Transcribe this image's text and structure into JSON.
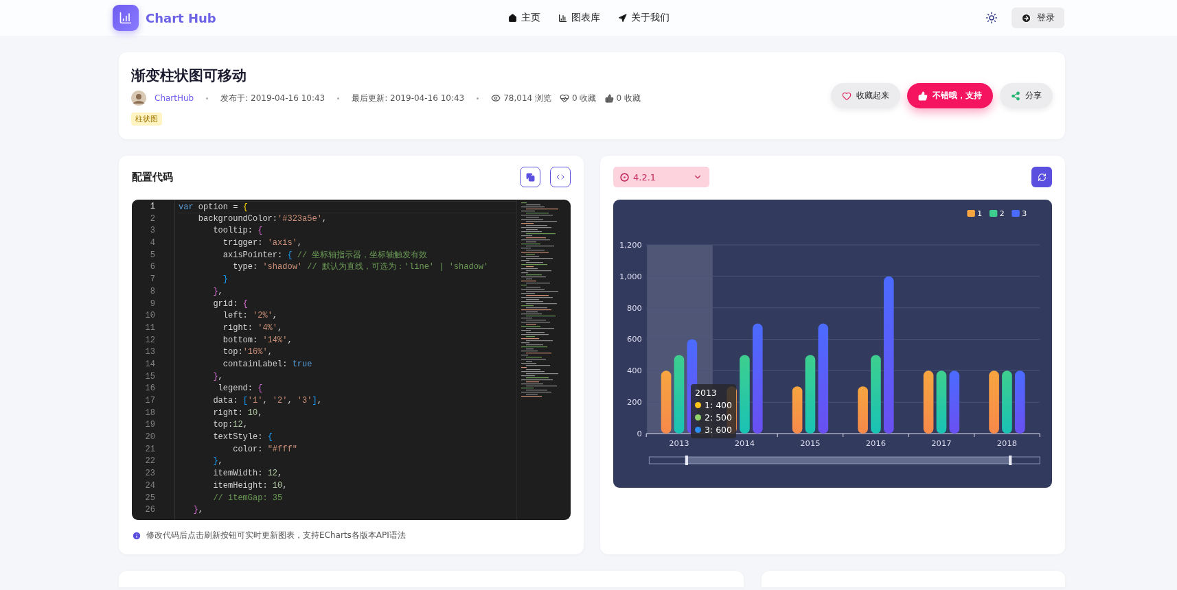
{
  "header": {
    "logo": "Chart Hub",
    "nav": [
      {
        "label": "主页",
        "kind": "home"
      },
      {
        "label": "图表库",
        "kind": "chart"
      },
      {
        "label": "关于我们",
        "kind": "about"
      }
    ],
    "login": "登录"
  },
  "article": {
    "title": "渐变柱状图可移动",
    "author": "ChartHub",
    "published": "发布于: 2019-04-16 10:43",
    "updated": "最后更新: 2019-04-16 10:43",
    "views": "78,014 浏览",
    "favorites": "0 收藏",
    "likes": "0 收藏",
    "tag": "柱状图",
    "actions": [
      {
        "label": "收藏起来",
        "kind": "favorite"
      },
      {
        "label": "不错哦，支持",
        "kind": "like"
      },
      {
        "label": "分享",
        "kind": "share"
      }
    ]
  },
  "code_panel": {
    "title": "配置代码",
    "hint": "修改代码后点击刷新按钮可实时更新图表，支持ECharts各版本API语法",
    "lines": [
      {
        "num": "1",
        "tokens": [
          {
            "text": "var",
            "kind": "keyword"
          },
          {
            "text": " option = ",
            "kind": "plain"
          },
          {
            "text": "{",
            "kind": "bracket1"
          }
        ]
      },
      {
        "num": "2",
        "tokens": [
          {
            "text": "    backgroundColor:",
            "kind": "plain"
          },
          {
            "text": "'#323a5e'",
            "kind": "string"
          },
          {
            "text": ",",
            "kind": "plain"
          }
        ]
      },
      {
        "num": "3",
        "tokens": [
          {
            "text": "       tooltip: ",
            "kind": "plain"
          },
          {
            "text": "{",
            "kind": "bracket2"
          }
        ]
      },
      {
        "num": "4",
        "tokens": [
          {
            "text": "         trigger: ",
            "kind": "plain"
          },
          {
            "text": "'axis'",
            "kind": "string"
          },
          {
            "text": ",",
            "kind": "plain"
          }
        ]
      },
      {
        "num": "5",
        "tokens": [
          {
            "text": "         axisPointer: ",
            "kind": "plain"
          },
          {
            "text": "{",
            "kind": "bracket3"
          },
          {
            "text": " // 坐标轴指示器，坐标轴触发有效",
            "kind": "comment"
          }
        ]
      },
      {
        "num": "6",
        "tokens": [
          {
            "text": "           type: ",
            "kind": "plain"
          },
          {
            "text": "'shadow'",
            "kind": "string"
          },
          {
            "text": " // 默认为直线，可选为：'line' | 'shadow'",
            "kind": "comment"
          }
        ]
      },
      {
        "num": "7",
        "tokens": [
          {
            "text": "         }",
            "kind": "bracket3"
          }
        ]
      },
      {
        "num": "8",
        "tokens": [
          {
            "text": "       }",
            "kind": "bracket2"
          },
          {
            "text": ",",
            "kind": "plain"
          }
        ]
      },
      {
        "num": "9",
        "tokens": [
          {
            "text": "       grid: ",
            "kind": "plain"
          },
          {
            "text": "{",
            "kind": "bracket2"
          }
        ]
      },
      {
        "num": "10",
        "tokens": [
          {
            "text": "         left: ",
            "kind": "plain"
          },
          {
            "text": "'2%'",
            "kind": "string"
          },
          {
            "text": ",",
            "kind": "plain"
          }
        ]
      },
      {
        "num": "11",
        "tokens": [
          {
            "text": "         right: ",
            "kind": "plain"
          },
          {
            "text": "'4%'",
            "kind": "string"
          },
          {
            "text": ",",
            "kind": "plain"
          }
        ]
      },
      {
        "num": "12",
        "tokens": [
          {
            "text": "         bottom: ",
            "kind": "plain"
          },
          {
            "text": "'14%'",
            "kind": "string"
          },
          {
            "text": ",",
            "kind": "plain"
          }
        ]
      },
      {
        "num": "13",
        "tokens": [
          {
            "text": "         top:",
            "kind": "plain"
          },
          {
            "text": "'16%'",
            "kind": "string"
          },
          {
            "text": ",",
            "kind": "plain"
          }
        ]
      },
      {
        "num": "14",
        "tokens": [
          {
            "text": "         containLabel: ",
            "kind": "plain"
          },
          {
            "text": "true",
            "kind": "keyword"
          }
        ]
      },
      {
        "num": "15",
        "tokens": [
          {
            "text": "       }",
            "kind": "bracket2"
          },
          {
            "text": ",",
            "kind": "plain"
          }
        ]
      },
      {
        "num": "16",
        "tokens": [
          {
            "text": "        legend: ",
            "kind": "plain"
          },
          {
            "text": "{",
            "kind": "bracket2"
          }
        ]
      },
      {
        "num": "17",
        "tokens": [
          {
            "text": "       data: ",
            "kind": "plain"
          },
          {
            "text": "[",
            "kind": "bracket3"
          },
          {
            "text": "'1'",
            "kind": "string"
          },
          {
            "text": ", ",
            "kind": "plain"
          },
          {
            "text": "'2'",
            "kind": "string"
          },
          {
            "text": ", ",
            "kind": "plain"
          },
          {
            "text": "'3'",
            "kind": "string"
          },
          {
            "text": "]",
            "kind": "bracket3"
          },
          {
            "text": ",",
            "kind": "plain"
          }
        ]
      },
      {
        "num": "18",
        "tokens": [
          {
            "text": "       right: ",
            "kind": "plain"
          },
          {
            "text": "10",
            "kind": "number"
          },
          {
            "text": ",",
            "kind": "plain"
          }
        ]
      },
      {
        "num": "19",
        "tokens": [
          {
            "text": "       top:",
            "kind": "plain"
          },
          {
            "text": "12",
            "kind": "number"
          },
          {
            "text": ",",
            "kind": "plain"
          }
        ]
      },
      {
        "num": "20",
        "tokens": [
          {
            "text": "       textStyle: ",
            "kind": "plain"
          },
          {
            "text": "{",
            "kind": "bracket3"
          }
        ]
      },
      {
        "num": "21",
        "tokens": [
          {
            "text": "           color: ",
            "kind": "plain"
          },
          {
            "text": "\"#fff\"",
            "kind": "string"
          }
        ]
      },
      {
        "num": "22",
        "tokens": [
          {
            "text": "       }",
            "kind": "bracket3"
          },
          {
            "text": ",",
            "kind": "plain"
          }
        ]
      },
      {
        "num": "23",
        "tokens": [
          {
            "text": "       itemWidth: ",
            "kind": "plain"
          },
          {
            "text": "12",
            "kind": "number"
          },
          {
            "text": ",",
            "kind": "plain"
          }
        ]
      },
      {
        "num": "24",
        "tokens": [
          {
            "text": "       itemHeight: ",
            "kind": "plain"
          },
          {
            "text": "10",
            "kind": "number"
          },
          {
            "text": ",",
            "kind": "plain"
          }
        ]
      },
      {
        "num": "25",
        "tokens": [
          {
            "text": "       // itemGap: 35",
            "kind": "comment"
          }
        ]
      },
      {
        "num": "26",
        "tokens": [
          {
            "text": "   }",
            "kind": "bracket2"
          },
          {
            "text": ",",
            "kind": "plain"
          }
        ]
      }
    ]
  },
  "chart_panel": {
    "version": "4.2.1",
    "chart_data": {
      "type": "bar",
      "categories": [
        "2013",
        "2014",
        "2015",
        "2016",
        "2017",
        "2018"
      ],
      "series": [
        {
          "name": "1",
          "color": "#f7a540",
          "values": [
            400,
            300,
            300,
            300,
            400,
            400
          ]
        },
        {
          "name": "2",
          "color": "#3ecf8e",
          "values": [
            500,
            500,
            500,
            500,
            400,
            400
          ]
        },
        {
          "name": "3",
          "color": "#4b6bff",
          "values": [
            600,
            700,
            700,
            1000,
            400,
            400
          ]
        }
      ],
      "grid": true,
      "legend": true,
      "bands": [
        {
          "axis": "x",
          "from": "2013",
          "to": "2013"
        }
      ],
      "ylim": [
        0,
        1200
      ],
      "yticks": [
        0,
        {
          "value": 200,
          "label": "200"
        },
        {
          "value": 400,
          "label": "400"
        },
        {
          "value": 600,
          "label": "600"
        },
        {
          "value": 800,
          "label": "800"
        },
        {
          "value": 1000,
          "label": "1,000"
        },
        {
          "value": 1200,
          "label": "1,200"
        }
      ]
    },
    "tooltip": {
      "title": "2013",
      "items": [
        {
          "label": "1: 400",
          "color": "#fcc419"
        },
        {
          "label": "2: 500",
          "color": "#8fd16b"
        },
        {
          "label": "3: 600",
          "color": "#2d8cf0"
        }
      ]
    }
  }
}
